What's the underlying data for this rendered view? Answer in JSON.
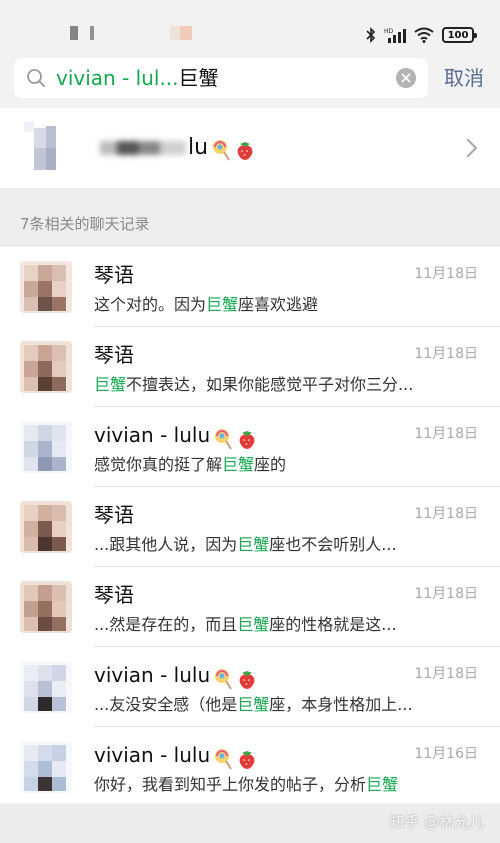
{
  "status_bar": {
    "battery": "100",
    "icons": [
      "bluetooth-icon",
      "signal-icon",
      "wifi-icon",
      "battery-icon"
    ]
  },
  "search": {
    "query_highlight": "vivian - lul...",
    "query_term": "巨蟹",
    "cancel_label": "取消"
  },
  "contact": {
    "name_suffix": "lu"
  },
  "section_header": "7条相关的聊天记录",
  "results": [
    {
      "name": "琴语",
      "time": "11月18日",
      "before": "这个对的。因为",
      "term": "巨蟹",
      "after": "座喜欢逃避",
      "emoji": false
    },
    {
      "name": "琴语",
      "time": "11月18日",
      "before": "",
      "term": "巨蟹",
      "after": "不擅表达，如果你能感觉平子对你三分...",
      "emoji": false
    },
    {
      "name": "vivian - lulu",
      "time": "11月18日",
      "before": "感觉你真的挺了解",
      "term": "巨蟹",
      "after": "座的",
      "emoji": true
    },
    {
      "name": "琴语",
      "time": "11月18日",
      "before": "...跟其他人说，因为",
      "term": "巨蟹",
      "after": "座也不会听别人...",
      "emoji": false
    },
    {
      "name": "琴语",
      "time": "11月18日",
      "before": "...然是存在的，而且",
      "term": "巨蟹",
      "after": "座的性格就是这...",
      "emoji": false
    },
    {
      "name": "vivian - lulu",
      "time": "11月18日",
      "before": "...友没安全感（他是",
      "term": "巨蟹",
      "after": "座，本身性格加上...",
      "emoji": true
    },
    {
      "name": "vivian - lulu",
      "time": "11月16日",
      "before": "你好，我看到知乎上你发的帖子，分析",
      "term": "巨蟹",
      "after": "",
      "emoji": true
    }
  ],
  "watermark": "知乎 @林允儿",
  "colors": {
    "highlight": "#15a74e",
    "link": "#576b95",
    "muted": "#aaaaaa"
  }
}
